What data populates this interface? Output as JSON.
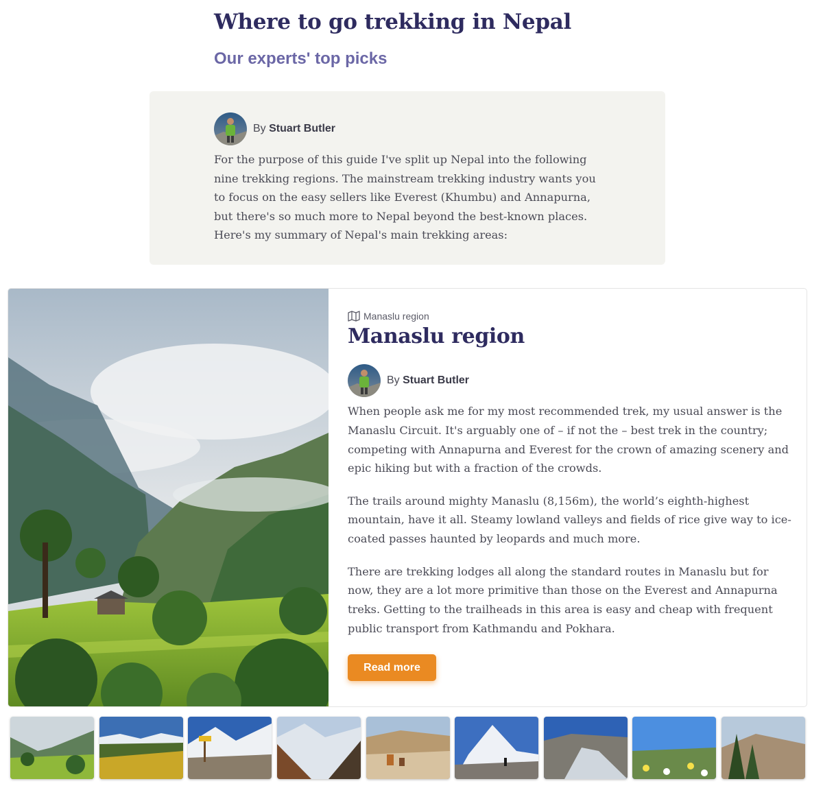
{
  "header": {
    "title": "Where to go trekking in Nepal",
    "subtitle": "Our experts' top picks"
  },
  "intro": {
    "author_prefix": "By",
    "author_name": "Stuart Butler",
    "text": "For the purpose of this guide I've split up Nepal into the following nine trekking regions. The mainstream trekking industry wants you to focus on the easy sellers like Everest (Khumbu) and Annapurna, but there's so much more to Nepal beyond the best-known places. Here's my summary of Nepal's main trekking areas:"
  },
  "card": {
    "crumb_icon": "map-icon",
    "crumb": "Manaslu region",
    "title": "Manaslu region",
    "author_prefix": "By",
    "author_name": "Stuart Butler",
    "paragraphs": [
      "When people ask me for my most recommended trek, my usual answer is the Manaslu Circuit. It's arguably one of – if not the – best trek in the country; competing with Annapurna and Everest for the crown of amazing scenery and epic hiking but with a fraction of the crowds.",
      "The trails around mighty Manaslu (8,156m), the world’s eighth-highest mountain, have it all. Steamy lowland valleys and fields of rice give way to ice-coated passes haunted by leopards and much more.",
      "There are trekking lodges all along the standard routes in Manaslu but for now, they are a lot more primitive than those on the Everest and Annapurna treks. Getting to the trailheads in this area is easy and cheap with frequent public transport from Kathmandu and Pokhara."
    ],
    "read_more_label": "Read more"
  },
  "colors": {
    "title": "#2e2b5f",
    "subtitle": "#6b67a6",
    "intro_bg": "#f3f3ef",
    "button": "#ea8a22"
  },
  "thumbnails": [
    {
      "name": "thumb-manaslu-valley"
    },
    {
      "name": "thumb-yellow-flowers-hillside"
    },
    {
      "name": "thumb-trail-sign-snow"
    },
    {
      "name": "thumb-mountain-gorge"
    },
    {
      "name": "thumb-mule-caravan"
    },
    {
      "name": "thumb-snow-peak-trekker"
    },
    {
      "name": "thumb-river-valley"
    },
    {
      "name": "thumb-wildflowers-sky"
    },
    {
      "name": "thumb-pine-forest-peaks"
    }
  ]
}
